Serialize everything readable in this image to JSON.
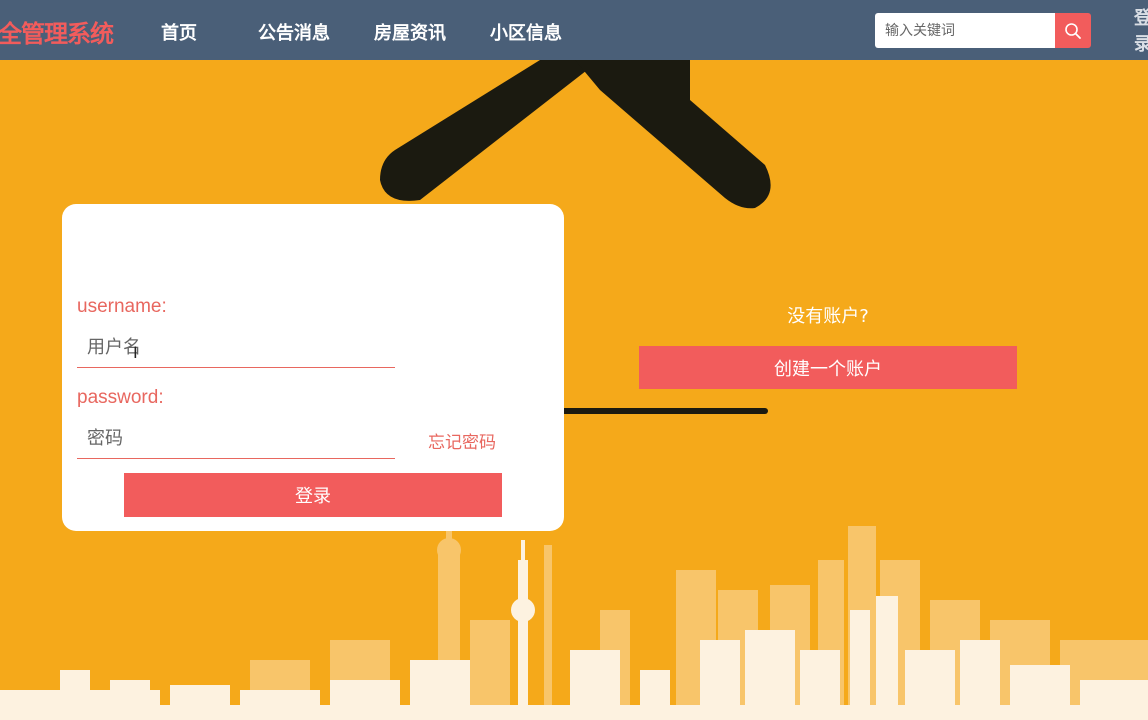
{
  "header": {
    "brand": "全管理系统",
    "nav": [
      "首页",
      "公告消息",
      "房屋资讯",
      "小区信息"
    ],
    "search_placeholder": "输入关键词",
    "search_icon": "search-icon",
    "login_link": "登录"
  },
  "login": {
    "username_label": "username:",
    "username_placeholder": "用户名",
    "password_label": "password:",
    "password_placeholder": "密码",
    "forgot_label": "忘记密码",
    "submit_label": "登录"
  },
  "register": {
    "prompt": "没有账户?",
    "button_label": "创建一个账户"
  },
  "colors": {
    "navbar": "#4A5F78",
    "background": "#F5A91A",
    "accent": "#F25C5C",
    "label": "#E8675F"
  }
}
